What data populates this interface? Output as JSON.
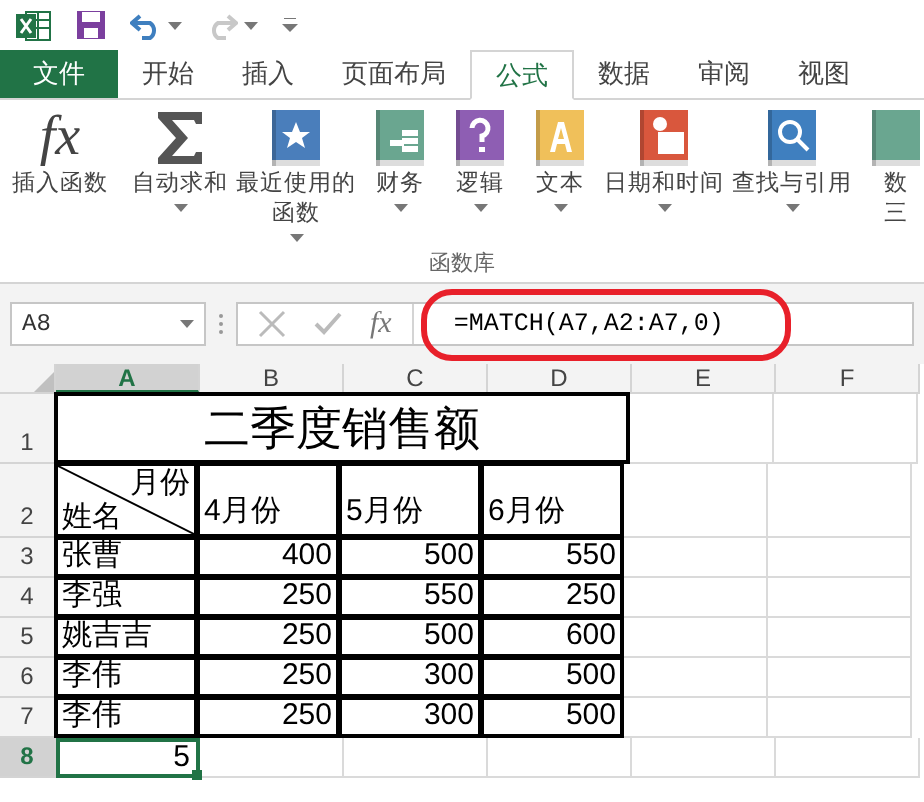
{
  "quick_access": {
    "redo_disabled": true
  },
  "tabs": [
    {
      "label": "文件",
      "kind": "file",
      "selected": false
    },
    {
      "label": "开始",
      "kind": "tab",
      "selected": false
    },
    {
      "label": "插入",
      "kind": "tab",
      "selected": false
    },
    {
      "label": "页面布局",
      "kind": "tab",
      "selected": false
    },
    {
      "label": "公式",
      "kind": "tab",
      "selected": true
    },
    {
      "label": "数据",
      "kind": "tab",
      "selected": false
    },
    {
      "label": "审阅",
      "kind": "tab",
      "selected": false
    },
    {
      "label": "视图",
      "kind": "tab",
      "selected": false
    }
  ],
  "ribbon": {
    "group_label": "函数库",
    "items": [
      {
        "kind": "fx",
        "icon_text": "fx",
        "label": [
          "插入函数"
        ],
        "dropdown": false
      },
      {
        "kind": "sigma",
        "label": [
          "自动求和"
        ],
        "dropdown": true
      },
      {
        "kind": "star",
        "color": "#4a7ebb",
        "label": [
          "最近使用的",
          "函数"
        ],
        "dropdown": true
      },
      {
        "kind": "coins",
        "color": "#6aa690",
        "label": [
          "财务"
        ],
        "dropdown": true
      },
      {
        "kind": "question",
        "color": "#8e5eb3",
        "label": [
          "逻辑"
        ],
        "dropdown": true
      },
      {
        "kind": "letter",
        "color": "#f0c05a",
        "label": [
          "文本"
        ],
        "dropdown": true
      },
      {
        "kind": "calendar",
        "color": "#d9573d",
        "label": [
          "日期和时间"
        ],
        "dropdown": true
      },
      {
        "kind": "search",
        "color": "#3f7fbf",
        "label": [
          "查找与引用"
        ],
        "dropdown": true
      },
      {
        "kind": "partial",
        "color": "#6aa690",
        "label": [
          "数",
          "三"
        ],
        "dropdown": false
      }
    ]
  },
  "formula_bar": {
    "fx_label": "fx",
    "name_box": "A8",
    "formula": "=MATCH(A7,A2:A7,0)"
  },
  "sheet": {
    "columns": [
      {
        "label": "A",
        "selected": true
      },
      {
        "label": "B",
        "selected": false
      },
      {
        "label": "C",
        "selected": false
      },
      {
        "label": "D",
        "selected": false
      },
      {
        "label": "E",
        "selected": false
      },
      {
        "label": "F",
        "selected": false
      }
    ],
    "row_labels": [
      {
        "label": "1",
        "selected": false
      },
      {
        "label": "2",
        "selected": false
      },
      {
        "label": "3",
        "selected": false
      },
      {
        "label": "4",
        "selected": false
      },
      {
        "label": "5",
        "selected": false
      },
      {
        "label": "6",
        "selected": false
      },
      {
        "label": "7",
        "selected": false
      },
      {
        "label": "8",
        "selected": true
      }
    ],
    "title": "二季度销售额",
    "corner_top": "月份",
    "corner_bottom": "姓名",
    "months": [
      "4月份",
      "5月份",
      "6月份"
    ],
    "rows": [
      {
        "name": "张曹",
        "values": [
          "400",
          "500",
          "550"
        ]
      },
      {
        "name": "李强",
        "values": [
          "250",
          "550",
          "250"
        ]
      },
      {
        "name": "姚吉吉",
        "values": [
          "250",
          "500",
          "600"
        ]
      },
      {
        "name": "李伟",
        "values": [
          "250",
          "300",
          "500"
        ]
      },
      {
        "name": "李伟",
        "values": [
          "250",
          "300",
          "500"
        ]
      }
    ],
    "result": "5"
  }
}
